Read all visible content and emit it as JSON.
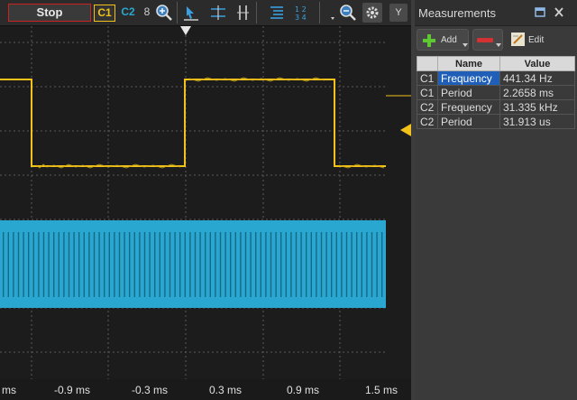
{
  "toolbar": {
    "stop_label": "Stop",
    "c1_label": "C1",
    "c2_label": "C2",
    "c8_label": "8",
    "icons": [
      "zoom-icon",
      "cursor-icon",
      "horizontal-cursors-icon",
      "vertical-cursors-icon",
      "list-icon",
      "numbers-icon",
      "zoom-search-icon",
      "settings-gear-icon"
    ],
    "y_label": "Y"
  },
  "colors": {
    "c1": "#f2c21a",
    "c2": "#2aa7d0",
    "grid": "#5a5a5a",
    "stop_border": "#cc2222",
    "selection": "#1f5fb8"
  },
  "plot": {
    "x_ticks": [
      "ms",
      "-0.9 ms",
      "-0.3 ms",
      "0.3 ms",
      "0.9 ms",
      "1.5 ms"
    ]
  },
  "measurements": {
    "title": "Measurements",
    "add_label": "Add",
    "edit_label": "Edit",
    "columns": [
      "",
      "Name",
      "Value"
    ],
    "rows": [
      {
        "channel": "C1",
        "name": "Frequency",
        "value": "441.34 Hz",
        "selected": true
      },
      {
        "channel": "C1",
        "name": "Period",
        "value": "2.2658 ms",
        "selected": false
      },
      {
        "channel": "C2",
        "name": "Frequency",
        "value": "31.335 kHz",
        "selected": false
      },
      {
        "channel": "C2",
        "name": "Period",
        "value": "31.913 us",
        "selected": false
      }
    ]
  }
}
